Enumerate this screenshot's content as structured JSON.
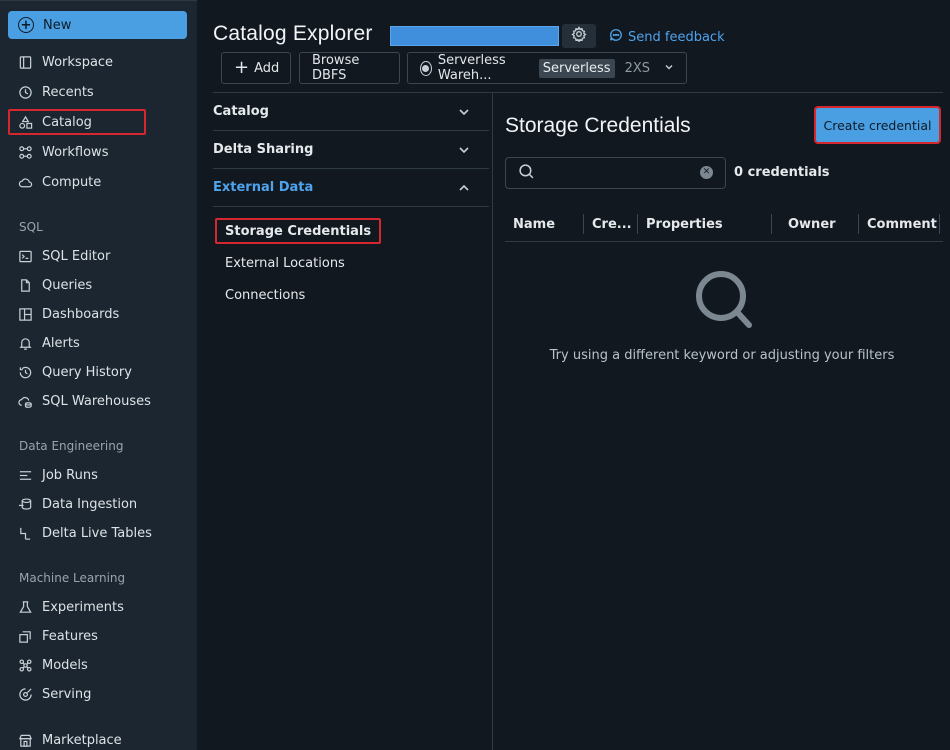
{
  "sidebar": {
    "new_label": "New",
    "items": [
      {
        "label": "Workspace",
        "icon": "workspace-icon"
      },
      {
        "label": "Recents",
        "icon": "clock-icon"
      },
      {
        "label": "Catalog",
        "icon": "catalog-icon",
        "selected": true
      },
      {
        "label": "Workflows",
        "icon": "workflows-icon"
      },
      {
        "label": "Compute",
        "icon": "cloud-icon"
      }
    ],
    "sql_section": "SQL",
    "sql_items": [
      {
        "label": "SQL Editor",
        "icon": "terminal-icon"
      },
      {
        "label": "Queries",
        "icon": "file-icon"
      },
      {
        "label": "Dashboards",
        "icon": "dashboard-icon"
      },
      {
        "label": "Alerts",
        "icon": "bell-icon"
      },
      {
        "label": "Query History",
        "icon": "history-icon"
      },
      {
        "label": "SQL Warehouses",
        "icon": "warehouse-icon"
      }
    ],
    "de_section": "Data Engineering",
    "de_items": [
      {
        "label": "Job Runs",
        "icon": "list-icon"
      },
      {
        "label": "Data Ingestion",
        "icon": "ingestion-icon"
      },
      {
        "label": "Delta Live Tables",
        "icon": "pipeline-icon"
      }
    ],
    "ml_section": "Machine Learning",
    "ml_items": [
      {
        "label": "Experiments",
        "icon": "flask-icon"
      },
      {
        "label": "Features",
        "icon": "features-icon"
      },
      {
        "label": "Models",
        "icon": "models-icon"
      },
      {
        "label": "Serving",
        "icon": "serving-icon"
      }
    ],
    "bottom_items": [
      {
        "label": "Marketplace",
        "icon": "store-icon"
      }
    ]
  },
  "header": {
    "title": "Catalog Explorer",
    "feedback_label": "Send feedback",
    "add_label": "Add",
    "browse_label": "Browse DBFS",
    "warehouse_name": "Serverless Wareh...",
    "warehouse_tag": "Serverless",
    "warehouse_size": "2XS"
  },
  "tree": {
    "catalog": "Catalog",
    "delta_sharing": "Delta Sharing",
    "external_data": "External Data",
    "sub_items": [
      "Storage Credentials",
      "External Locations",
      "Connections"
    ]
  },
  "main": {
    "title": "Storage Credentials",
    "create_label": "Create credential",
    "search_placeholder": "",
    "count_label": "0 credentials",
    "columns": [
      "Name",
      "Cre...",
      "Properties",
      "Owner",
      "Comment"
    ],
    "empty_text": "Try using a different keyword or adjusting your filters"
  },
  "colors": {
    "accent": "#4a9fe3",
    "link": "#4fa3ec",
    "highlight": "#d6262e",
    "sidebar_bg": "#1b2630",
    "page_bg": "#111820"
  }
}
